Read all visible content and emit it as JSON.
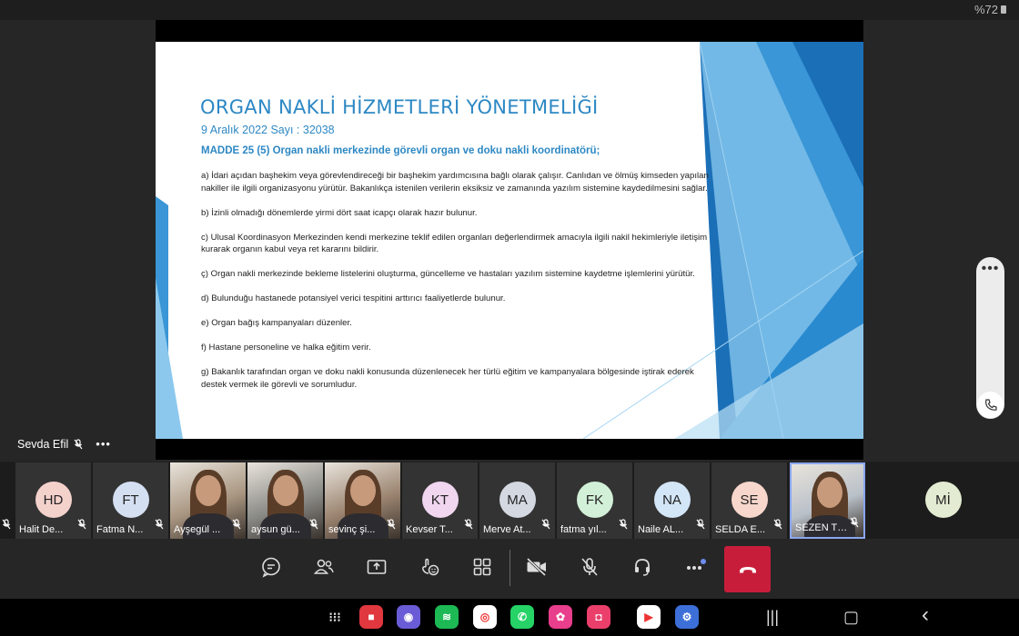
{
  "status": {
    "battery": "%72"
  },
  "slide": {
    "title": "ORGAN NAKLİ HİZMETLERİ YÖNETMELİĞİ",
    "subtitle": "9 Aralık 2022 Sayı : 32038",
    "heading": "MADDE 25 (5) Organ nakli merkezinde görevli organ ve doku nakli koordinatörü;",
    "items": [
      "a) İdari açıdan başhekim veya görevlendireceği bir başhekim yardımcısına bağlı olarak çalışır. Canlıdan ve ölmüş kimseden yapılan nakiller ile ilgili organizasyonu yürütür. Bakanlıkça istenilen verilerin eksiksiz ve zamanında yazılım sistemine kaydedilmesini sağlar.",
      "b) İzinli olmadığı dönemlerde yirmi dört saat icapçı olarak hazır bulunur.",
      "c) Ulusal Koordinasyon Merkezinden kendi merkezine teklif edilen organları değerlendirmek amacıyla ilgili nakil hekimleriyle iletişim kurarak organın kabul veya ret kararını bildirir.",
      "ç) Organ nakli merkezinde bekleme listelerini oluşturma, güncelleme ve hastaları yazılım sistemine kaydetme işlemlerini yürütür.",
      "d) Bulunduğu hastanede potansiyel verici tespitini arttırıcı faaliyetlerde bulunur.",
      "e) Organ bağış kampanyaları düzenler.",
      "f) Hastane personeline ve halka eğitim verir.",
      "g) Bakanlık tarafından organ ve doku nakli konusunda düzenlenecek her türlü eğitim ve kampanyalara bölgesinde iştirak ederek destek vermek ile görevli ve sorumludur."
    ]
  },
  "presenter": {
    "name": "Sevda Efil",
    "more": "•••"
  },
  "side_panel": {
    "more": "•••",
    "icon": "phone-icon"
  },
  "participants": [
    {
      "initials": "HD",
      "name": "Halit De...",
      "color": "#f4d2cc",
      "video": false
    },
    {
      "initials": "FT",
      "name": "Fatma N...",
      "color": "#d5dff2",
      "video": false
    },
    {
      "initials": "",
      "name": "Ayşegül ...",
      "color": "#a89580",
      "video": true
    },
    {
      "initials": "",
      "name": "aysun gü...",
      "color": "#8a8a86",
      "video": true
    },
    {
      "initials": "",
      "name": "sevinç şi...",
      "color": "#9b8470",
      "video": true
    },
    {
      "initials": "KT",
      "name": "Kevser T...",
      "color": "#f0d6ef",
      "video": false
    },
    {
      "initials": "MA",
      "name": "Merve At...",
      "color": "#d3d8e1",
      "video": false
    },
    {
      "initials": "FK",
      "name": "fatma  yıl...",
      "color": "#d2f0d8",
      "video": false
    },
    {
      "initials": "NA",
      "name": "Naile AL...",
      "color": "#d3e6f7",
      "video": false
    },
    {
      "initials": "SE",
      "name": "SELDA E...",
      "color": "#f7d7cc",
      "video": false
    },
    {
      "initials": "",
      "name": "SEZEN TUR...",
      "color": "#b9c0c8",
      "video": true
    },
    {
      "initials": "Mİ",
      "name": "",
      "color": "#e3ecd2",
      "video": false
    }
  ],
  "controls": [
    "chat-icon",
    "people-icon",
    "share-screen-icon",
    "reactions-icon",
    "apps-grid-icon",
    "camera-off-icon",
    "mic-off-icon",
    "headset-icon",
    "more-options-icon",
    "end-call-icon"
  ],
  "dock_apps": [
    {
      "name": "apps-drawer-icon",
      "color": "transparent",
      "glyph": "⁝⁝⁝"
    },
    {
      "name": "notes-app-icon",
      "color": "#e0383e",
      "glyph": "■"
    },
    {
      "name": "browser-app-icon",
      "color": "#6a5cd6",
      "glyph": "◉"
    },
    {
      "name": "spotify-app-icon",
      "color": "#1db954",
      "glyph": "≋"
    },
    {
      "name": "chrome-app-icon",
      "color": "#ffffff",
      "glyph": "◎"
    },
    {
      "name": "whatsapp-app-icon",
      "color": "#25d366",
      "glyph": "✆"
    },
    {
      "name": "flower-app-icon",
      "color": "#e83e8c",
      "glyph": "✿"
    },
    {
      "name": "camera-app-icon",
      "color": "#ea3f6b",
      "glyph": "◘"
    },
    {
      "name": "play-store-app-icon",
      "color": "#ffffff",
      "glyph": "▶"
    },
    {
      "name": "settings-app-icon",
      "color": "#3d6fd8",
      "glyph": "⚙"
    }
  ]
}
